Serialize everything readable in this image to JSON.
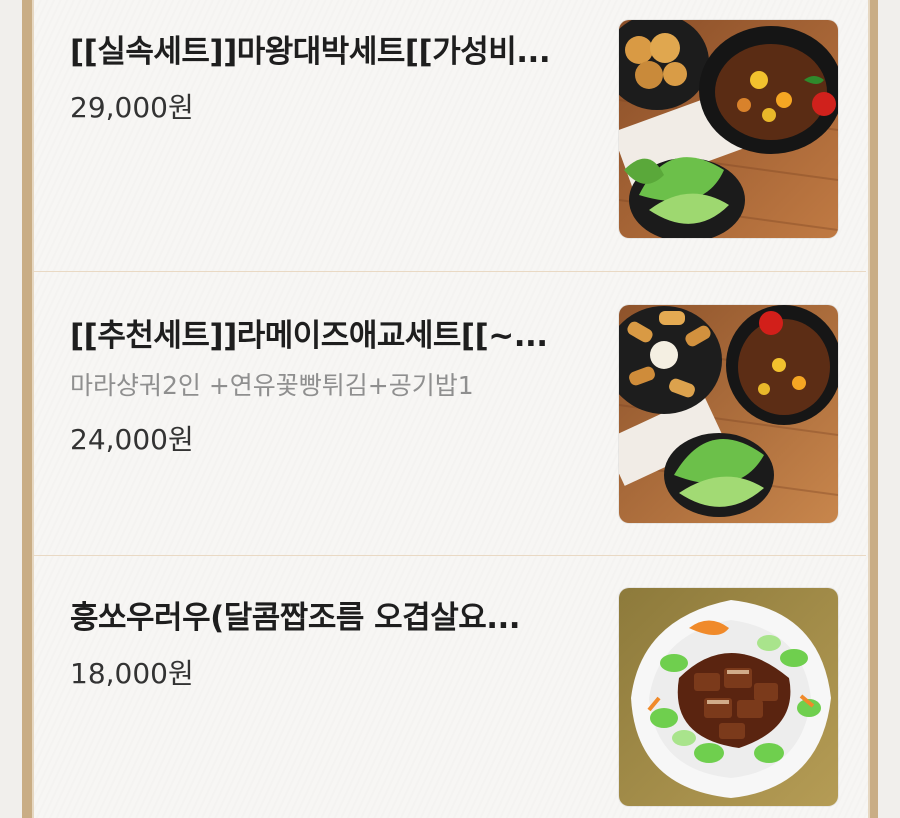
{
  "menu": {
    "items": [
      {
        "title": "[[실속세트]]마왕대박세트[[가성비...",
        "description": "",
        "price": "29,000원",
        "image": "food-photo-set-fried-and-spicy-dishes"
      },
      {
        "title": "[[추천세트]]라메이즈애교세트[[~...",
        "description": "마라샹궈2인 +연유꽃빵튀김+공기밥1",
        "price": "24,000원",
        "image": "food-photo-set-fried-buns-and-mala"
      },
      {
        "title": "훙쏘우러우(달콤짭조름 오겹살요...",
        "description": "",
        "price": "18,000원",
        "image": "food-photo-braised-pork-with-bok-choy"
      }
    ]
  },
  "colors": {
    "frame_border": "#c9ad85",
    "divider": "#e9d9c4",
    "title": "#1e1e1e",
    "description": "#8f8f8f",
    "price": "#333333"
  }
}
